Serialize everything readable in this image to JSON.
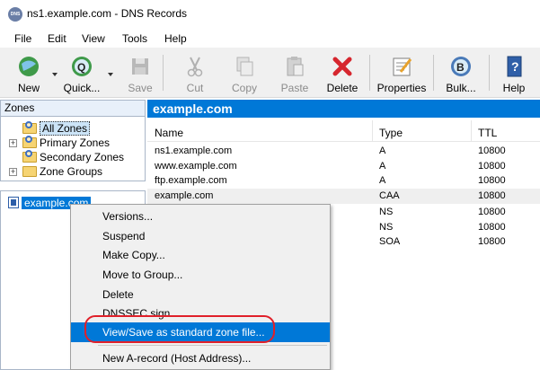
{
  "window": {
    "title": "ns1.example.com - DNS Records",
    "app_icon_text": "DNS"
  },
  "menubar": [
    "File",
    "Edit",
    "View",
    "Tools",
    "Help"
  ],
  "toolbar": {
    "new": "New",
    "quick": "Quick...",
    "save": "Save",
    "cut": "Cut",
    "copy": "Copy",
    "paste": "Paste",
    "delete": "Delete",
    "properties": "Properties",
    "bulk": "Bulk...",
    "help": "Help"
  },
  "zones_panel": {
    "header": "Zones",
    "tree": [
      "All Zones",
      "Primary Zones",
      "Secondary Zones",
      "Zone Groups"
    ],
    "selected_zone": "example.com"
  },
  "records_panel": {
    "header": "example.com",
    "columns": [
      "Name",
      "Type",
      "TTL"
    ],
    "rows": [
      {
        "name": "ns1.example.com",
        "type": "A",
        "ttl": "10800"
      },
      {
        "name": "www.example.com",
        "type": "A",
        "ttl": "10800"
      },
      {
        "name": "ftp.example.com",
        "type": "A",
        "ttl": "10800"
      },
      {
        "name": "example.com",
        "type": "CAA",
        "ttl": "10800"
      },
      {
        "name": "",
        "type": "NS",
        "ttl": "10800"
      },
      {
        "name": "",
        "type": "NS",
        "ttl": "10800"
      },
      {
        "name": "",
        "type": "SOA",
        "ttl": "10800"
      }
    ]
  },
  "context_menu": {
    "items": [
      "Versions...",
      "Suspend",
      "Make Copy...",
      "Move to Group...",
      "Delete",
      "DNSSEC sign",
      "View/Save as standard zone file...",
      "New A-record (Host Address)..."
    ],
    "highlighted_index": 6
  },
  "colors": {
    "selection": "#0078d7",
    "callout": "#e0202a"
  }
}
